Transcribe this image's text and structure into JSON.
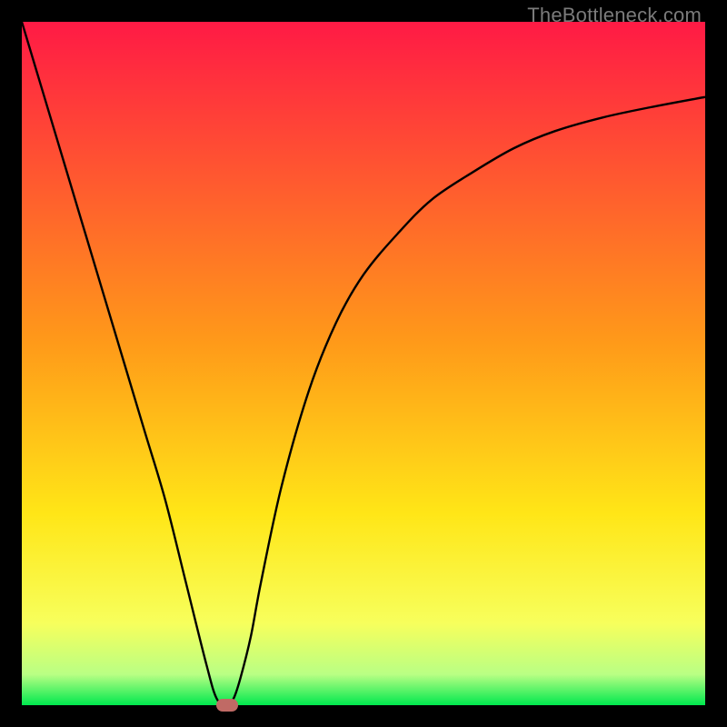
{
  "watermark": "TheBottleneck.com",
  "chart_data": {
    "type": "line",
    "title": "",
    "xlabel": "",
    "ylabel": "",
    "xlim": [
      0,
      100
    ],
    "ylim": [
      0,
      100
    ],
    "grid": false,
    "legend": false,
    "background_gradient": {
      "stops": [
        {
          "offset": 0.0,
          "color": "#ff1a45"
        },
        {
          "offset": 0.47,
          "color": "#ff9a19"
        },
        {
          "offset": 0.72,
          "color": "#ffe617"
        },
        {
          "offset": 0.88,
          "color": "#f7ff5c"
        },
        {
          "offset": 0.955,
          "color": "#b9ff84"
        },
        {
          "offset": 1.0,
          "color": "#00e84e"
        }
      ]
    },
    "series": [
      {
        "name": "bottleneck-curve",
        "color": "#000000",
        "x": [
          0,
          3,
          6,
          9,
          12,
          15,
          18,
          21,
          24,
          27,
          28.5,
          30,
          31,
          32,
          33.5,
          35,
          38,
          42,
          46,
          50,
          55,
          60,
          66,
          72,
          78,
          85,
          92,
          100
        ],
        "y": [
          100,
          90,
          80,
          70,
          60,
          50,
          40,
          30,
          18,
          6,
          1,
          0,
          1,
          4,
          10,
          18,
          32,
          46,
          56,
          63,
          69,
          74,
          78,
          81.5,
          84,
          86,
          87.5,
          89
        ]
      }
    ],
    "marker": {
      "x": 30,
      "y": 0,
      "color": "#c06a65"
    }
  }
}
